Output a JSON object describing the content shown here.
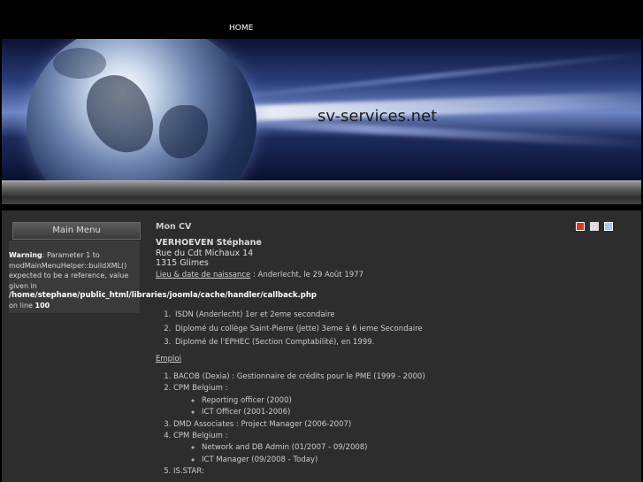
{
  "nav": {
    "home": "HOME"
  },
  "banner": {
    "site_title": "sv-services.net"
  },
  "sidebar": {
    "menu_title": "Main Menu",
    "warning": {
      "label": "Warning",
      "text": ": Parameter 1 to modMainMenuHelper::buildXML() expected to be a reference, value given in",
      "path": "/home/stephane/public_html/libraries/joomla/cache/handler/callback.php",
      "online_prefix": "on line",
      "line": "100"
    }
  },
  "content": {
    "title": "Mon CV",
    "icons": [
      "pdf-icon",
      "print-icon",
      "email-icon"
    ],
    "name": "VERHOEVEN Stéphane",
    "address1": "Rue du Cdt Michaux 14",
    "address2": "1315 Glimes",
    "birth_label": "Lieu & date de naissance",
    "birth_value": " : Anderlecht, le 29 Août 1977",
    "education": [
      "ISDN (Anderlecht) 1er et 2eme secondaire",
      "Diplomé du collège Saint-Pierre (Jette) 3eme à 6 ieme Secondaire",
      "Diplomé de l'EPHEC (Section Comptabilité), en 1999."
    ],
    "emploi_label": "Emploi",
    "jobs": [
      {
        "label": "BACOB (Dexia) : Gestionnaire de crédits pour le PME (1999 - 2000)",
        "sub": []
      },
      {
        "label": "CPM Belgium :",
        "sub": [
          "Reporting officer (2000)",
          "ICT Officer (2001-2006)"
        ]
      },
      {
        "label": "DMD Associates : Project Manager (2006-2007)",
        "sub": []
      },
      {
        "label": "CPM Belgium :",
        "sub": [
          "Network and DB Admin (01/2007 - 09/2008)",
          "ICT Manager (09/2008 - Today)"
        ]
      },
      {
        "label": "IS.STAR:",
        "sub": []
      }
    ]
  }
}
